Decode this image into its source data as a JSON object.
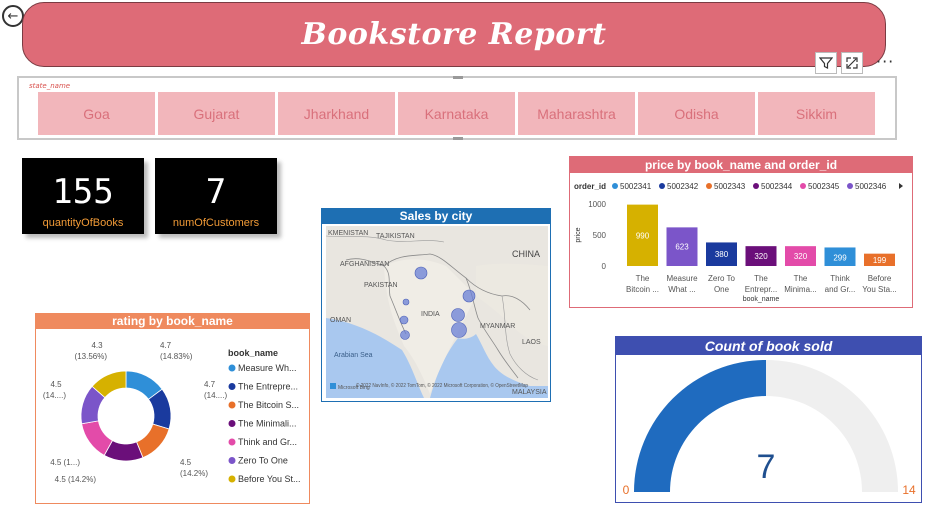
{
  "header": {
    "title": "Bookstore Report",
    "back_icon": "back-arrow-icon"
  },
  "visual_actions": {
    "icons": [
      "filter-icon",
      "focus-mode-icon",
      "more-options-icon"
    ],
    "more_label": "···"
  },
  "slicer": {
    "field_label": "state_name",
    "items": [
      "Goa",
      "Gujarat",
      "Jharkhand",
      "Karnataka",
      "Maharashtra",
      "Odisha",
      "Sikkim"
    ]
  },
  "kpis": [
    {
      "value": "155",
      "label": "quantityOfBooks"
    },
    {
      "value": "7",
      "label": "numOfCustomers"
    }
  ],
  "map": {
    "title": "Sales by city",
    "labels": [
      "KMENISTAN",
      "TAJIKISTAN",
      "AFGHANISTAN",
      "PAKISTAN",
      "CHINA",
      "INDIA",
      "MYANMAR",
      "OMAN",
      "Arabian Sea",
      "LAOS",
      "MALAYSIA"
    ],
    "attribution": "© 2022 NavInfo, © 2022 TomTom, © 2022 Microsoft Corporation, © OpenStreetMap",
    "logo": "Microsoft Bing",
    "bubble_color": "#6a7fd6"
  },
  "chart_data": [
    {
      "type": "bar",
      "title": "price by book_name and order_id",
      "legend_title": "order_id",
      "legend_entries": [
        "5002341",
        "5002342",
        "5002343",
        "5002344",
        "5002345",
        "5002346"
      ],
      "legend_colors": [
        "#2f8fd8",
        "#1a3a9e",
        "#e8702a",
        "#6b0f7a",
        "#e34ba9",
        "#7b55c9"
      ],
      "categories": [
        "The Bitcoin ...",
        "Measure What ...",
        "Zero To One",
        "The Entrepr...",
        "The Minima...",
        "Think and Gr...",
        "Before You Sta..."
      ],
      "values": [
        990,
        623,
        380,
        320,
        320,
        299,
        199
      ],
      "bar_colors": [
        "#d6b100",
        "#7b55c9",
        "#1a3a9e",
        "#6b0f7a",
        "#e34ba9",
        "#2f8fd8",
        "#e8702a"
      ],
      "data_labels": [
        "990",
        "623",
        "380",
        "320",
        "320",
        "299",
        "199"
      ],
      "xlabel": "book_name",
      "ylabel": "price",
      "yticks": [
        "0",
        "500",
        "1000"
      ],
      "ylim": [
        0,
        1000
      ]
    },
    {
      "type": "pie",
      "title": "rating by book_name",
      "legend_title": "book_name",
      "legend": [
        "Measure Wh...",
        "The Entrepre...",
        "The Bitcoin S...",
        "The Minimali...",
        "Think and Gr...",
        "Zero To One",
        "Before You St..."
      ],
      "colors": [
        "#2f8fd8",
        "#1a3a9e",
        "#e8702a",
        "#6b0f7a",
        "#e34ba9",
        "#7b55c9",
        "#d6b100"
      ],
      "values": [
        4.7,
        4.7,
        4.5,
        4.5,
        4.5,
        4.5,
        4.3
      ],
      "data_labels": [
        "4.7\n(14.83%)",
        "4.7\n(14....)",
        "4.5\n(14.2%)",
        "4.5 (14.2%)",
        "4.5 (1...)",
        "4.5\n(14....)",
        "4.3\n(13.56%)"
      ]
    },
    {
      "type": "gauge",
      "title": "Count of book sold",
      "value": 7,
      "min": 0,
      "max": 14,
      "value_label": "7",
      "min_label": "0",
      "max_label": "14",
      "fill_color": "#1f6bbf",
      "track_color": "#efefef"
    }
  ]
}
